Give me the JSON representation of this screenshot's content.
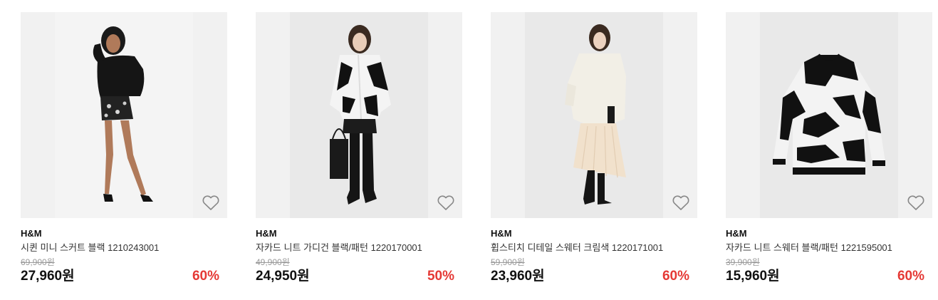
{
  "products": [
    {
      "brand": "H&M",
      "name": "시퀸 미니 스커트 블랙 1210243001",
      "original_price": "69,900원",
      "price": "27,960원",
      "discount": "60%",
      "image_icon": "model-sequin-skirt-photo",
      "wishlist_icon": "heart-outline-icon"
    },
    {
      "brand": "H&M",
      "name": "자카드 니트 가디건 블랙/패턴 1220170001",
      "original_price": "49,900원",
      "price": "24,950원",
      "discount": "50%",
      "image_icon": "model-jacquard-cardigan-photo",
      "wishlist_icon": "heart-outline-icon"
    },
    {
      "brand": "H&M",
      "name": "휩스티치 디테일 스웨터 크림색 1220171001",
      "original_price": "59,900원",
      "price": "23,960원",
      "discount": "60%",
      "image_icon": "model-cream-sweater-photo",
      "wishlist_icon": "heart-outline-icon"
    },
    {
      "brand": "H&M",
      "name": "자카드 니트 스웨터 블랙/패턴 1221595001",
      "original_price": "39,900원",
      "price": "15,960원",
      "discount": "60%",
      "image_icon": "jacquard-sweater-flatlay-photo",
      "wishlist_icon": "heart-outline-icon"
    }
  ],
  "colors": {
    "discount": "#e53935",
    "price": "#111111",
    "original_price": "#999999"
  }
}
